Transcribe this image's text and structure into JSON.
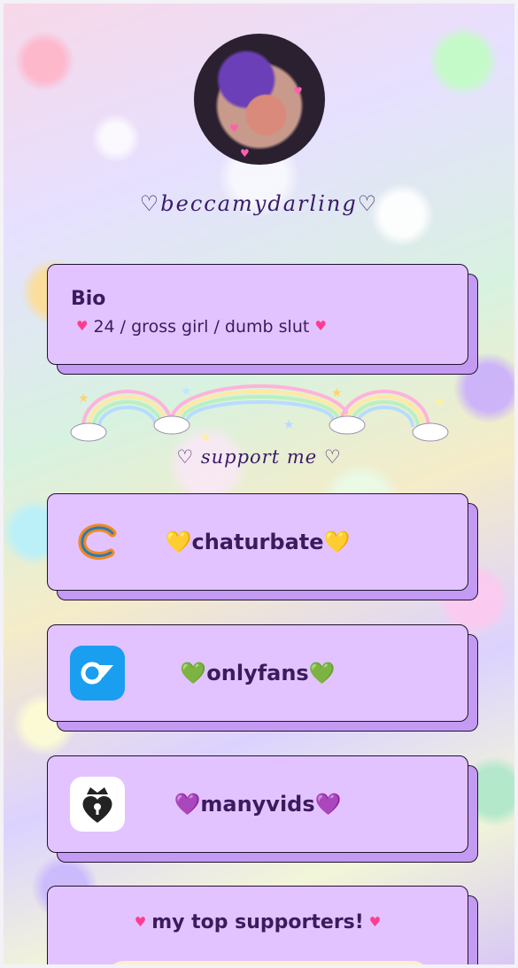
{
  "profile": {
    "username": "♡beccamydarling♡"
  },
  "bio": {
    "title": "Bio",
    "text": "24 / gross girl / dumb slut"
  },
  "support": {
    "heading": "♡ support me ♡"
  },
  "links": [
    {
      "label": "chaturbate",
      "emoji": "💛",
      "icon": "chaturbate-icon"
    },
    {
      "label": "onlyfans",
      "emoji": "💚",
      "icon": "onlyfans-icon"
    },
    {
      "label": "manyvids",
      "emoji": "💜",
      "icon": "manyvids-icon"
    }
  ],
  "top_supporters": {
    "label": "my top supporters!"
  },
  "colors": {
    "card": "#e2c3ff",
    "card_shadow": "#c49bf3",
    "text": "#3d1a5e",
    "heart": "#ff3d8f"
  }
}
